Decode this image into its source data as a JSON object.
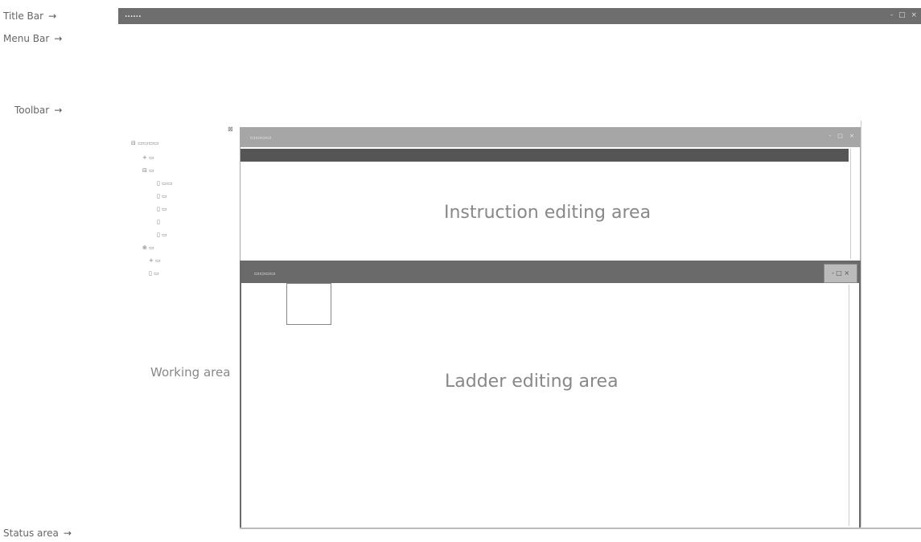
{
  "callouts": {
    "title_bar": "Title Bar",
    "menu_bar": "Menu Bar",
    "toolbar": "Toolbar",
    "status_area": "Status area"
  },
  "titlebar": {
    "title": "......",
    "buttons": "- □ ×"
  },
  "menubar": {
    "items": [
      "",
      "",
      "",
      "",
      "",
      "",
      "",
      "",
      "",
      "",
      "",
      ""
    ]
  },
  "toolbar": {
    "row1": "",
    "row2": "",
    "row3": ""
  },
  "labels": {
    "working_area": "Working area",
    "instruction_editing_area": "Instruction editing area",
    "ladder_editing_area": "Ladder editing area"
  },
  "instr_table": {
    "rows": [
      "",
      "",
      "",
      "",
      "",
      "",
      "",
      ""
    ]
  },
  "status": {
    "left": "",
    "center": "",
    "right": ""
  },
  "colors": {
    "titlebar": "#6e6e6e",
    "window_title_active": "#6a6a6a",
    "window_title_inactive": "#a6a6a6"
  }
}
